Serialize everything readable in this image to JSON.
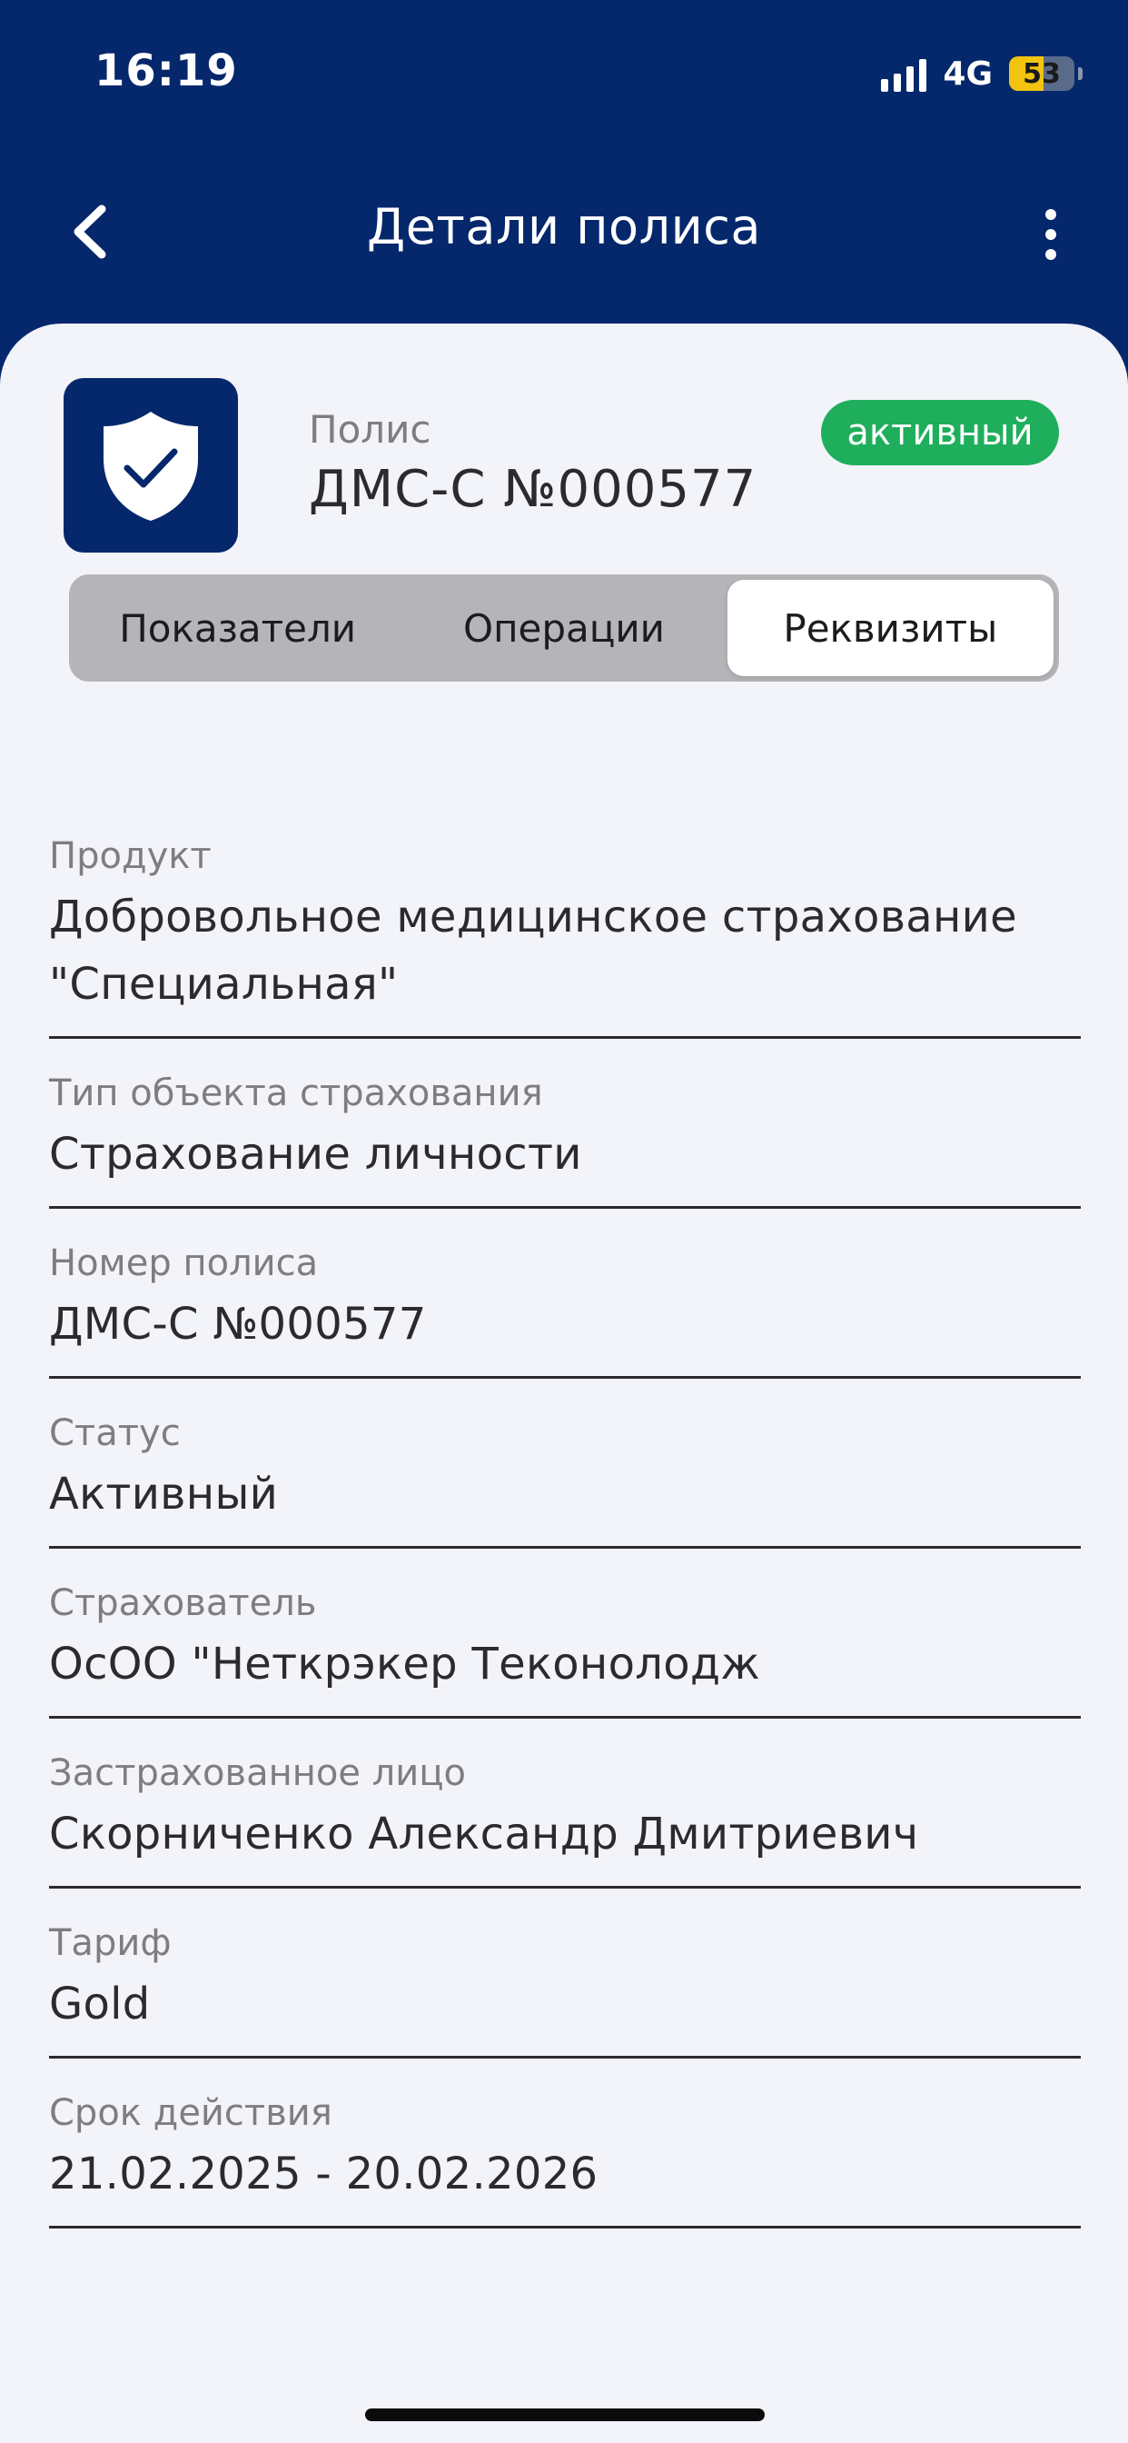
{
  "status_bar": {
    "time": "16:19",
    "network": "4G",
    "battery": "53",
    "battery_level": 0.53
  },
  "nav": {
    "title": "Детали полиса",
    "back_icon": "chevron-left-icon",
    "more_icon": "more-vertical-icon"
  },
  "policy": {
    "logo_icon": "shield-check-icon",
    "label": "Полис",
    "number": "ДМС-С №000577",
    "status": "активный",
    "status_color": "#1fae5b"
  },
  "tabs": [
    {
      "label": "Показатели",
      "active": false
    },
    {
      "label": "Операции",
      "active": false
    },
    {
      "label": "Реквизиты",
      "active": true
    }
  ],
  "details": [
    {
      "label": "Продукт",
      "value": "Добровольное медицинское страхование \"Специальная\""
    },
    {
      "label": "Тип объекта страхования",
      "value": "Страхование личности"
    },
    {
      "label": "Номер полиса",
      "value": "ДМС-С №000577"
    },
    {
      "label": "Статус",
      "value": "Активный"
    },
    {
      "label": "Страхователь",
      "value": "ОсОО \"Неткрэкер Теконолодж"
    },
    {
      "label": "Застрахованное лицо",
      "value": "Скорниченко Александр Дмитриевич"
    },
    {
      "label": "Тариф",
      "value": "Gold"
    },
    {
      "label": "Срок действия",
      "value": "21.02.2025 - 20.02.2026"
    }
  ],
  "colors": {
    "brand": "#05276b",
    "background": "#f3f4fa",
    "active_badge": "#1fae5b"
  }
}
